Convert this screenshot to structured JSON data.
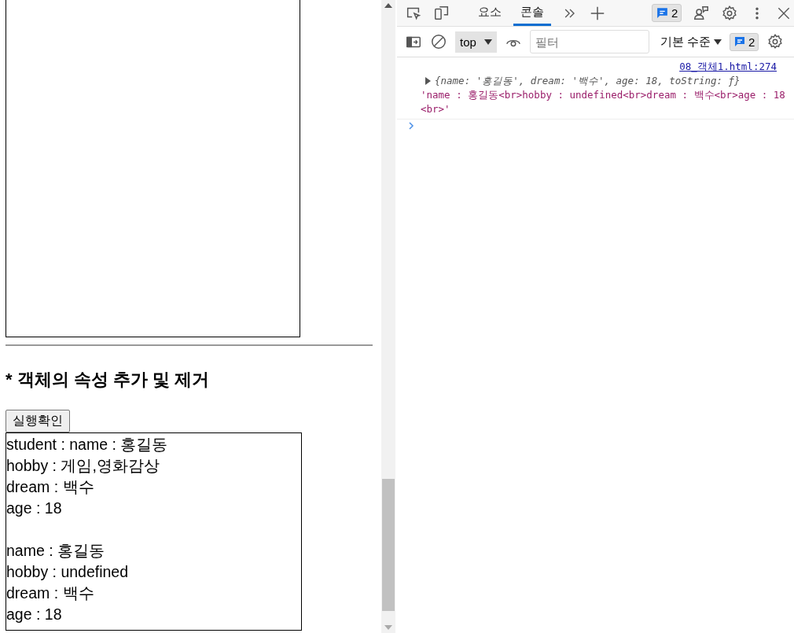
{
  "page": {
    "section_heading": "* 객체의 속성 추가 및 제거",
    "run_button": "실행확인",
    "output_groups": [
      [
        "student : name : 홍길동",
        "hobby : 게임,영화감상",
        "dream : 백수",
        "age : 18"
      ],
      [
        "name : 홍길동",
        "hobby : undefined",
        "dream : 백수",
        "age : 18"
      ]
    ]
  },
  "devtools": {
    "tabs": [
      {
        "label": "요소",
        "selected": false
      },
      {
        "label": "콘솔",
        "selected": true
      }
    ],
    "issues_count": "2",
    "console_toolbar": {
      "context": "top",
      "filter_placeholder": "필터",
      "log_level": "기본 수준",
      "issues_count": "2"
    },
    "console": {
      "source_link": "08_객체1.html:274",
      "object_preview": "{name: '홍길동', dream: '백수', age: 18, toString: ƒ}",
      "object_expanded": false,
      "string_output": "'name : 홍길동<br>hobby : undefined<br>dream : 백수<br>age : 18<br>'"
    }
  }
}
